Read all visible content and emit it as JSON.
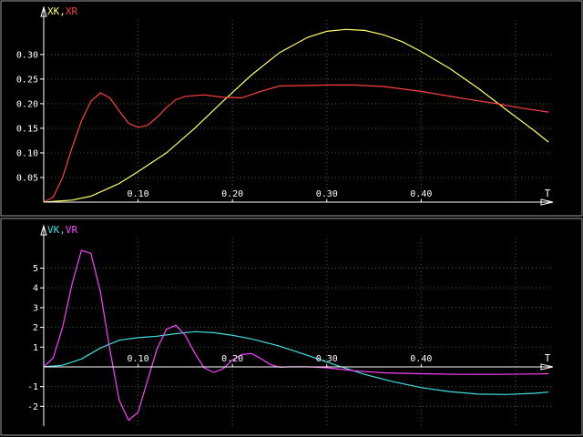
{
  "colors": {
    "background": "#000000",
    "frame": "#9a9a9a",
    "grid": "#2e6b2e",
    "axis": "#ffffff",
    "XK": "#ffff66",
    "XR": "#ff4040",
    "VK": "#40e0e0",
    "VR": "#ff40ff"
  },
  "chart_data": [
    {
      "type": "line",
      "title_parts": [
        {
          "text": "XK,",
          "color": "#ffff66"
        },
        {
          "text": "XR",
          "color": "#ff4040"
        }
      ],
      "xlabel": "T",
      "xlim": [
        0,
        0.53
      ],
      "ylim": [
        0,
        0.37
      ],
      "x_ticks": [
        0.1,
        0.2,
        0.3,
        0.4
      ],
      "x_tick_labels": [
        "0.10",
        "0.20",
        "0.30",
        "0.40"
      ],
      "y_ticks": [
        0.05,
        0.1,
        0.15,
        0.2,
        0.25,
        0.3
      ],
      "y_tick_labels": [
        "0.05",
        "0.10",
        "0.15",
        "0.20",
        "0.25",
        "0.30"
      ],
      "grid": true,
      "series": [
        {
          "key": "XK",
          "color": "#ffff66",
          "x": [
            0,
            0.03,
            0.05,
            0.08,
            0.1,
            0.13,
            0.16,
            0.19,
            0.22,
            0.25,
            0.28,
            0.3,
            0.32,
            0.34,
            0.36,
            0.38,
            0.4,
            0.43,
            0.46,
            0.49,
            0.52,
            0.535
          ],
          "y": [
            0,
            0.004,
            0.012,
            0.038,
            0.062,
            0.1,
            0.15,
            0.205,
            0.258,
            0.304,
            0.335,
            0.347,
            0.351,
            0.349,
            0.34,
            0.326,
            0.306,
            0.272,
            0.232,
            0.188,
            0.145,
            0.122
          ]
        },
        {
          "key": "XR",
          "color": "#ff4040",
          "x": [
            0,
            0.01,
            0.02,
            0.03,
            0.04,
            0.05,
            0.06,
            0.07,
            0.08,
            0.09,
            0.1,
            0.11,
            0.12,
            0.13,
            0.14,
            0.15,
            0.17,
            0.19,
            0.21,
            0.23,
            0.25,
            0.28,
            0.3,
            0.33,
            0.36,
            0.4,
            0.44,
            0.48,
            0.51,
            0.535
          ],
          "y": [
            0,
            0.01,
            0.05,
            0.11,
            0.165,
            0.205,
            0.222,
            0.212,
            0.185,
            0.16,
            0.152,
            0.156,
            0.172,
            0.192,
            0.208,
            0.215,
            0.218,
            0.213,
            0.212,
            0.225,
            0.236,
            0.237,
            0.238,
            0.238,
            0.235,
            0.225,
            0.212,
            0.2,
            0.19,
            0.183
          ]
        }
      ]
    },
    {
      "type": "line",
      "title_parts": [
        {
          "text": "VK,",
          "color": "#40e0e0"
        },
        {
          "text": "VR",
          "color": "#ff40ff"
        }
      ],
      "xlabel": "T",
      "xlim": [
        0,
        0.53
      ],
      "ylim": [
        -3,
        6.5
      ],
      "x_ticks": [
        0.1,
        0.2,
        0.3,
        0.4
      ],
      "x_tick_labels": [
        "0.10",
        "0.20",
        "0.30",
        "0.40"
      ],
      "y_ticks": [
        -2,
        -1,
        1,
        2,
        3,
        4,
        5
      ],
      "y_tick_labels": [
        "-2",
        "-1",
        "1",
        "2",
        "3",
        "4",
        "5"
      ],
      "grid": true,
      "series": [
        {
          "key": "VK",
          "color": "#40e0e0",
          "x": [
            0,
            0.02,
            0.04,
            0.06,
            0.08,
            0.1,
            0.12,
            0.14,
            0.16,
            0.18,
            0.2,
            0.22,
            0.25,
            0.28,
            0.31,
            0.34,
            0.37,
            0.4,
            0.43,
            0.46,
            0.49,
            0.52,
            0.535
          ],
          "y": [
            0,
            0.08,
            0.4,
            0.95,
            1.35,
            1.48,
            1.55,
            1.68,
            1.78,
            1.73,
            1.6,
            1.42,
            1.05,
            0.58,
            0.08,
            -0.38,
            -0.75,
            -1.05,
            -1.25,
            -1.38,
            -1.4,
            -1.34,
            -1.28
          ]
        },
        {
          "key": "VR",
          "color": "#ff40ff",
          "x": [
            0,
            0.01,
            0.02,
            0.03,
            0.04,
            0.05,
            0.06,
            0.07,
            0.08,
            0.09,
            0.1,
            0.11,
            0.12,
            0.13,
            0.14,
            0.15,
            0.16,
            0.17,
            0.18,
            0.19,
            0.2,
            0.21,
            0.22,
            0.23,
            0.24,
            0.25,
            0.26,
            0.28,
            0.3,
            0.33,
            0.36,
            0.4,
            0.44,
            0.48,
            0.52,
            0.535
          ],
          "y": [
            0,
            0.45,
            2.0,
            4.2,
            5.9,
            5.75,
            3.8,
            0.9,
            -1.7,
            -2.7,
            -2.3,
            -0.7,
            0.9,
            1.9,
            2.1,
            1.6,
            0.7,
            -0.05,
            -0.28,
            -0.1,
            0.35,
            0.62,
            0.68,
            0.42,
            0.12,
            -0.02,
            0.0,
            0.0,
            -0.05,
            -0.2,
            -0.3,
            -0.35,
            -0.38,
            -0.38,
            -0.36,
            -0.35
          ]
        }
      ]
    }
  ]
}
